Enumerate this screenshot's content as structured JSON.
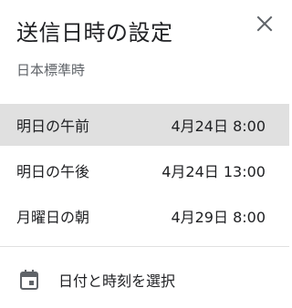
{
  "dialog": {
    "title": "送信日時の設定",
    "close_icon": "close-icon",
    "subtitle": "日本標準時"
  },
  "options": [
    {
      "label": "明日の午前",
      "time": "4月24日 8:00",
      "selected": true
    },
    {
      "label": "明日の午後",
      "time": "4月24日 13:00",
      "selected": false
    },
    {
      "label": "月曜日の朝",
      "time": "4月29日 8:00",
      "selected": false
    }
  ],
  "custom": {
    "icon": "calendar-icon",
    "label": "日付と時刻を選択"
  },
  "colors": {
    "selected_background": "#e0e0e0",
    "text": "#202124",
    "secondary_text": "#5f6368",
    "icon": "#5f6368"
  }
}
